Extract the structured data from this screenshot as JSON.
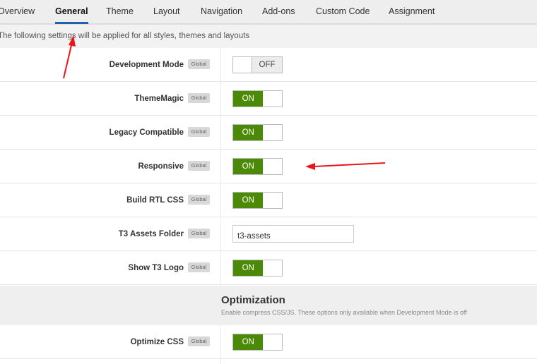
{
  "tabs": [
    "Overview",
    "General",
    "Theme",
    "Layout",
    "Navigation",
    "Add-ons",
    "Custom Code",
    "Assignment"
  ],
  "active_tab": "General",
  "info": "The following settings will be applied for all styles, themes and layouts",
  "badge": "Global",
  "rows": [
    {
      "label": "Development Mode",
      "type": "toggle",
      "value": "OFF"
    },
    {
      "label": "ThemeMagic",
      "type": "toggle",
      "value": "ON"
    },
    {
      "label": "Legacy Compatible",
      "type": "toggle",
      "value": "ON"
    },
    {
      "label": "Responsive",
      "type": "toggle",
      "value": "ON"
    },
    {
      "label": "Build RTL CSS",
      "type": "toggle",
      "value": "ON"
    },
    {
      "label": "T3 Assets Folder",
      "type": "text",
      "value": "t3-assets"
    },
    {
      "label": "Show T3 Logo",
      "type": "toggle",
      "value": "ON"
    }
  ],
  "section": {
    "title": "Optimization",
    "desc": "Enable compress CSS/JS. These options only available when Development Mode is off"
  },
  "rows2": [
    {
      "label": "Optimize CSS",
      "type": "toggle",
      "value": "ON"
    }
  ],
  "colors": {
    "on": "#4b8a06",
    "tab_underline": "#1f63ae",
    "arrow": "#e8151b"
  }
}
